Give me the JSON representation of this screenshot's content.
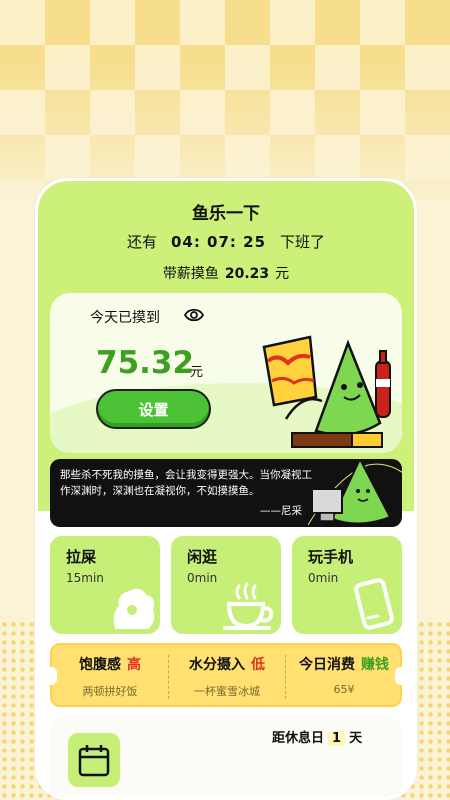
{
  "header": {
    "title": "鱼乐一下",
    "countdown_prefix": "还有",
    "countdown_time": "04: 07: 25",
    "countdown_suffix": "下班了",
    "salary_label": "带薪摸鱼",
    "salary_value": "20.23",
    "salary_unit": "元"
  },
  "today": {
    "label": "今天已摸到",
    "amount": "75.32",
    "unit": "元",
    "settings_button": "设置"
  },
  "quote": {
    "text": "那些杀不死我的摸鱼，会让我变得更强大。当你凝视工作深渊时，深渊也在凝视你，不如摸摸鱼。",
    "author": "——尼采"
  },
  "activities": [
    {
      "name": "拉屎",
      "time": "15min",
      "icon": "toilet-paper-icon"
    },
    {
      "name": "闲逛",
      "time": "0min",
      "icon": "coffee-cup-icon"
    },
    {
      "name": "玩手机",
      "time": "0min",
      "icon": "phone-icon"
    }
  ],
  "stats": [
    {
      "label": "饱腹感",
      "level": "高",
      "level_color": "#e0321f",
      "sub": "两顿拼好饭"
    },
    {
      "label": "水分摄入",
      "level": "低",
      "level_color": "#e0321f",
      "sub": "一杯蜜雪冰城"
    },
    {
      "label": "今日消费",
      "level": "赚钱",
      "level_color": "#3da022",
      "sub": "65¥"
    }
  ],
  "next_rest": {
    "label": "距休息日",
    "days": "1",
    "unit": "天",
    "icon": "calendar-icon"
  },
  "colors": {
    "accent_green": "#cdf07a",
    "button_green": "#4cc336",
    "amount_green": "#3da022",
    "stats_yellow": "#ffe071"
  }
}
